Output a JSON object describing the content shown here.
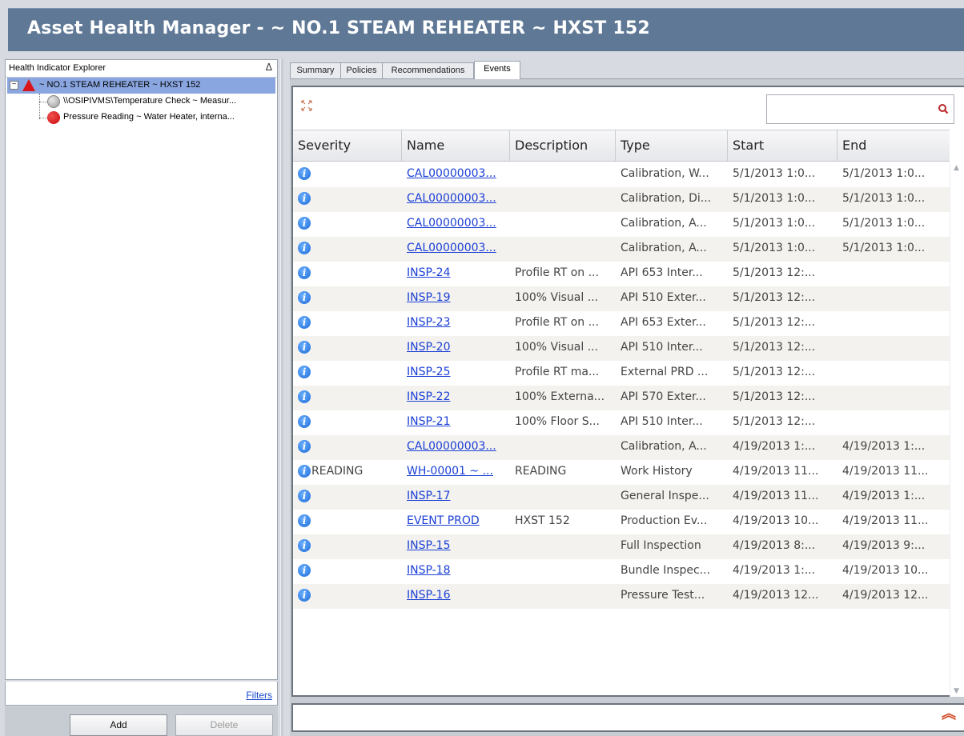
{
  "window": {
    "title": "Asset Health Manager -  ~ NO.1 STEAM REHEATER ~ HXST 152"
  },
  "explorer": {
    "header": "Health Indicator Explorer",
    "sort_glyph": "Δ",
    "root": {
      "label": "~ NO.1 STEAM REHEATER ~ HXST 152",
      "expander": "−",
      "status": "alert-triangle-red"
    },
    "children": [
      {
        "label": "\\\\OSIPIVMS\\Temperature Check ~ Measur...",
        "status": "gray"
      },
      {
        "label": "Pressure Reading ~ Water Heater, interna...",
        "status": "red"
      }
    ],
    "filters_link": "Filters",
    "add_button": "Add",
    "delete_button": "Delete"
  },
  "tabs": [
    {
      "label": "Summary",
      "active": false
    },
    {
      "label": "Policies",
      "active": false
    },
    {
      "label": "Recommendations",
      "active": false
    },
    {
      "label": "Events",
      "active": true
    }
  ],
  "grid": {
    "search": {
      "value": "",
      "placeholder": ""
    },
    "columns": [
      "Severity",
      "Name",
      "Description",
      "Type",
      "Start",
      "End"
    ],
    "rows": [
      {
        "severity": "",
        "name": "CAL00000003...",
        "description": "",
        "type": "Calibration, W...",
        "start": "5/1/2013 1:0...",
        "end": "5/1/2013 1:0..."
      },
      {
        "severity": "",
        "name": "CAL00000003...",
        "description": "",
        "type": "Calibration, Di...",
        "start": "5/1/2013 1:0...",
        "end": "5/1/2013 1:0..."
      },
      {
        "severity": "",
        "name": "CAL00000003...",
        "description": "",
        "type": "Calibration, A...",
        "start": "5/1/2013 1:0...",
        "end": "5/1/2013 1:0..."
      },
      {
        "severity": "",
        "name": "CAL00000003...",
        "description": "",
        "type": "Calibration, A...",
        "start": "5/1/2013 1:0...",
        "end": "5/1/2013 1:0..."
      },
      {
        "severity": "",
        "name": "INSP-24",
        "description": "Profile RT on ...",
        "type": "API 653 Inter...",
        "start": "5/1/2013 12:...",
        "end": ""
      },
      {
        "severity": "",
        "name": "INSP-19",
        "description": "100% Visual ...",
        "type": "API 510 Exter...",
        "start": "5/1/2013 12:...",
        "end": ""
      },
      {
        "severity": "",
        "name": "INSP-23",
        "description": "Profile RT on ...",
        "type": "API 653 Exter...",
        "start": "5/1/2013 12:...",
        "end": ""
      },
      {
        "severity": "",
        "name": "INSP-20",
        "description": "100% Visual ...",
        "type": "API 510 Inter...",
        "start": "5/1/2013 12:...",
        "end": ""
      },
      {
        "severity": "",
        "name": "INSP-25",
        "description": "Profile RT ma...",
        "type": "External PRD ...",
        "start": "5/1/2013 12:...",
        "end": ""
      },
      {
        "severity": "",
        "name": "INSP-22",
        "description": "100% Externa...",
        "type": "API 570 Exter...",
        "start": "5/1/2013 12:...",
        "end": ""
      },
      {
        "severity": "",
        "name": "INSP-21",
        "description": "100% Floor S...",
        "type": "API 510 Inter...",
        "start": "5/1/2013 12:...",
        "end": ""
      },
      {
        "severity": "",
        "name": "CAL00000003...",
        "description": "",
        "type": "Calibration, A...",
        "start": "4/19/2013 1:...",
        "end": "4/19/2013 1:..."
      },
      {
        "severity": "READING",
        "name": "WH-00001 ~ ...",
        "description": "READING",
        "type": "Work History",
        "start": "4/19/2013 11...",
        "end": "4/19/2013 11..."
      },
      {
        "severity": "",
        "name": "INSP-17",
        "description": "",
        "type": "General Inspe...",
        "start": "4/19/2013 11...",
        "end": "4/19/2013 1:..."
      },
      {
        "severity": "",
        "name": "EVENT PROD",
        "description": "HXST 152",
        "type": "Production Ev...",
        "start": "4/19/2013 10...",
        "end": "4/19/2013 11..."
      },
      {
        "severity": "",
        "name": "INSP-15",
        "description": "",
        "type": "Full Inspection",
        "start": "4/19/2013 8:...",
        "end": "4/19/2013 9:..."
      },
      {
        "severity": "",
        "name": "INSP-18",
        "description": "",
        "type": "Bundle Inspec...",
        "start": "4/19/2013 1:...",
        "end": "4/19/2013 10..."
      },
      {
        "severity": "",
        "name": "INSP-16",
        "description": "",
        "type": "Pressure Test...",
        "start": "4/19/2013 12...",
        "end": "4/19/2013 12..."
      }
    ]
  },
  "colors": {
    "titlebar": "#5f7896",
    "selection": "#8aa6e0",
    "link": "#1a3fd6",
    "info_icon": "#1c6ad8",
    "alert_red": "#d9141a"
  }
}
